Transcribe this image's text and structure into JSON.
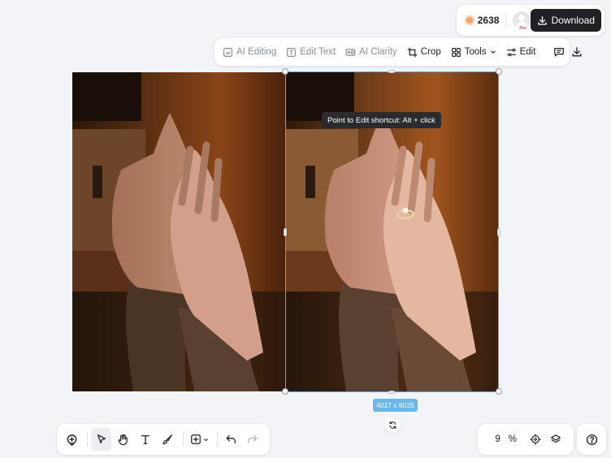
{
  "account": {
    "credits": "2638",
    "avatar_badge": "Pro",
    "download_label": "Download"
  },
  "toolbar": {
    "ai_editing": "AI Editing",
    "edit_text": "Edit Text",
    "ai_clarity": "AI Clarity",
    "crop": "Crop",
    "tools": "Tools",
    "edit": "Edit"
  },
  "canvas": {
    "tooltip": "Point to Edit shortcut: Alt + click",
    "dimensions": "4017 x 6025"
  },
  "zoom": {
    "value": "9",
    "unit": "%"
  },
  "colors": {
    "accent": "#5aa9e6",
    "download_bg": "#1f2124",
    "background": "#f3f4f8"
  }
}
